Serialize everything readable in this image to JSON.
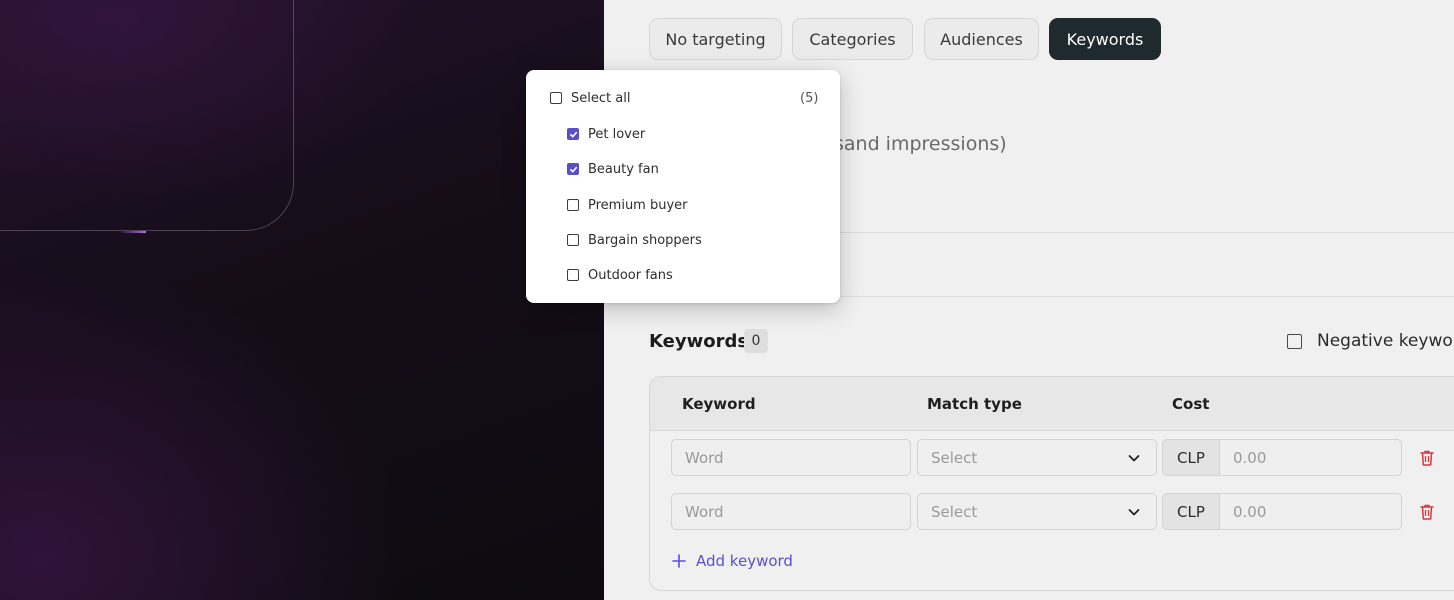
{
  "tabs": [
    {
      "label": "No targeting",
      "active": false
    },
    {
      "label": "Categories",
      "active": false
    },
    {
      "label": "Audiences",
      "active": false
    },
    {
      "label": "Keywords",
      "active": true
    }
  ],
  "partial_text": "sand impressions)",
  "keywords": {
    "title": "Keywords",
    "count": "0",
    "negative_label": "Negative keyword",
    "headers": {
      "keyword": "Keyword",
      "match_type": "Match type",
      "cost": "Cost"
    },
    "rows": [
      {
        "word_placeholder": "Word",
        "match_placeholder": "Select",
        "currency": "CLP",
        "cost_placeholder": "0.00"
      },
      {
        "word_placeholder": "Word",
        "match_placeholder": "Select",
        "currency": "CLP",
        "cost_placeholder": "0.00"
      }
    ],
    "add_label": "Add keyword"
  },
  "audience_dropdown": {
    "select_all_label": "Select all",
    "count_label": "(5)",
    "options": [
      {
        "label": "Pet lover",
        "checked": true
      },
      {
        "label": "Beauty fan",
        "checked": true
      },
      {
        "label": "Premium buyer",
        "checked": false
      },
      {
        "label": "Bargain shoppers",
        "checked": false
      },
      {
        "label": "Outdoor fans",
        "checked": false
      }
    ]
  },
  "colors": {
    "active_tab": "#1f2a2e",
    "accent": "#5b4fc7",
    "link": "#5a4fd0",
    "delete": "#d9363e"
  },
  "icons": {
    "chevron": "chevron-down-icon",
    "trash": "trash-icon",
    "plus": "plus-icon",
    "check": "check-icon"
  }
}
